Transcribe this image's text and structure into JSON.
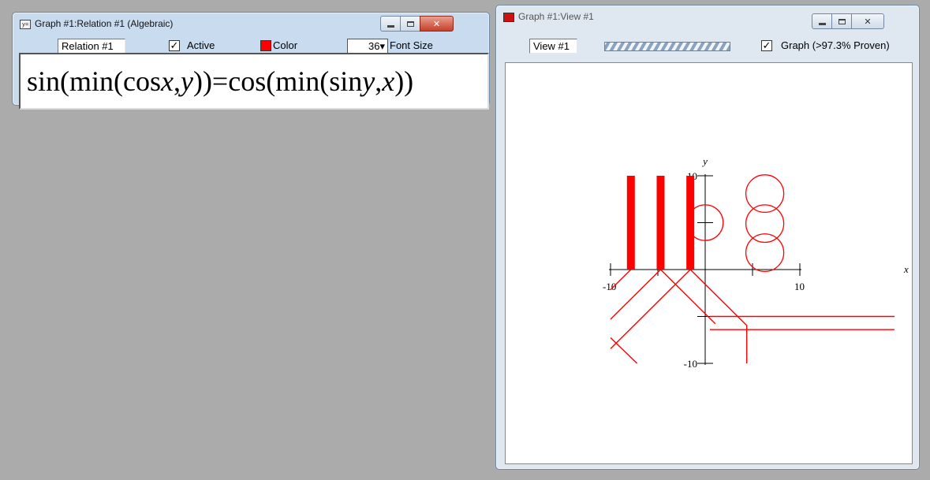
{
  "relation_window": {
    "title": "Graph #1:Relation #1 (Algebraic)",
    "name_value": "Relation #1",
    "active_label": "Active",
    "active_checked": true,
    "color_label": "Color",
    "color_value": "#ff0000",
    "font_size_value": "36",
    "font_size_label": "Font Size",
    "formula": {
      "p1": "sin(min(cos",
      "v1": "x",
      "p2": ",",
      "v2": "y",
      "p3": "))=cos(min(sin",
      "v3": "y",
      "p4": ",",
      "v4": "x",
      "p5": "))"
    }
  },
  "view_window": {
    "title": "Graph #1:View #1",
    "view_name_value": "View #1",
    "graph_label": "Graph (>97.3% Proven)",
    "graph_checked": true
  },
  "chart_data": {
    "type": "line",
    "xlabel": "x",
    "ylabel": "y",
    "xlim": [
      -10,
      10
    ],
    "ylim": [
      -10,
      10
    ],
    "x_tick_labels": [
      "-10",
      "10"
    ],
    "y_tick_labels": [
      "10",
      "-10"
    ],
    "series_color": "#ff0000",
    "curves": [
      {
        "kind": "vertical-band",
        "points": [
          [
            -7.85,
            0
          ],
          [
            -7.85,
            10
          ]
        ]
      },
      {
        "kind": "vertical-band",
        "points": [
          [
            -4.71,
            0
          ],
          [
            -4.71,
            10
          ]
        ]
      },
      {
        "kind": "vertical-band",
        "points": [
          [
            -1.57,
            0
          ],
          [
            -1.57,
            10
          ]
        ]
      },
      {
        "kind": "line",
        "points": [
          [
            -7.85,
            0
          ],
          [
            -10,
            -2.15
          ]
        ]
      },
      {
        "kind": "line",
        "points": [
          [
            -4.71,
            0
          ],
          [
            -10,
            -5.29
          ]
        ]
      },
      {
        "kind": "line",
        "points": [
          [
            -4.71,
            0
          ],
          [
            1.07,
            -5.78
          ]
        ]
      },
      {
        "kind": "line",
        "points": [
          [
            -1.57,
            0
          ],
          [
            -10,
            -8.43
          ]
        ]
      },
      {
        "kind": "line",
        "points": [
          [
            -1.57,
            0
          ],
          [
            4.39,
            -5.96
          ],
          [
            4.39,
            -10
          ]
        ]
      },
      {
        "kind": "line",
        "points": [
          [
            -10,
            -7.27
          ],
          [
            -7.2,
            -10
          ]
        ]
      },
      {
        "kind": "line",
        "points": [
          [
            0.5,
            -5.0
          ],
          [
            20,
            -5.0
          ]
        ]
      },
      {
        "kind": "line",
        "points": [
          [
            0.5,
            -6.4
          ],
          [
            20,
            -6.4
          ]
        ]
      },
      {
        "kind": "circle",
        "center": [
          0,
          5
        ],
        "r": 0.95
      },
      {
        "kind": "circle",
        "center": [
          6.3,
          8.1
        ],
        "r": 1.0
      },
      {
        "kind": "circle",
        "center": [
          6.3,
          4.9
        ],
        "r": 1.0
      },
      {
        "kind": "circle",
        "center": [
          6.3,
          1.8
        ],
        "r": 1.0
      }
    ]
  }
}
